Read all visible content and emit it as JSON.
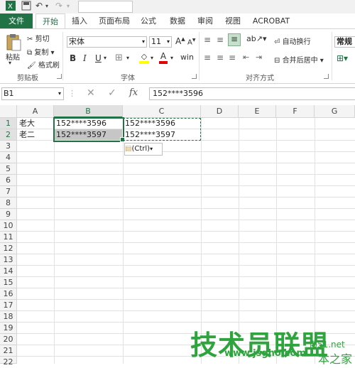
{
  "tabs": [
    "文件",
    "开始",
    "插入",
    "页面布局",
    "公式",
    "数据",
    "审阅",
    "视图",
    "ACROBAT"
  ],
  "clipboard": {
    "paste": "粘贴",
    "cut": "剪切",
    "copy": "复制",
    "format_painter": "格式刷",
    "label": "剪贴板"
  },
  "font": {
    "name": "宋体",
    "size": "11",
    "bold": "B",
    "italic": "I",
    "underline": "U",
    "label": "字体",
    "grow": "A",
    "shrink": "A"
  },
  "alignment": {
    "wrap": "自动换行",
    "merge": "合并后居中",
    "label": "对齐方式"
  },
  "number": {
    "format": "常规"
  },
  "formula_bar": {
    "name_box": "B1",
    "fx": "fx",
    "value": "152****3596"
  },
  "columns": [
    "A",
    "B",
    "C",
    "D",
    "E",
    "F",
    "G"
  ],
  "rows": [
    "1",
    "2",
    "3",
    "4",
    "5",
    "6",
    "7",
    "8",
    "9",
    "10",
    "11",
    "12",
    "13",
    "14",
    "15",
    "16",
    "17",
    "18",
    "19",
    "20",
    "21",
    "22"
  ],
  "cells": {
    "A1": "老大",
    "B1": "152****3596",
    "C1": "152****3596",
    "A2": "老二",
    "B2": "152****3597",
    "C2": "152****3597"
  },
  "paste_options": "(Ctrl)",
  "watermark": {
    "main": "技术员联盟",
    "url": "www.jsgho.com",
    "tail1": "jb51.net",
    "tail2": "本之家"
  },
  "colors": {
    "accent": "#217346",
    "selection": "#c6c6c6",
    "watermark": "#2fa33e"
  }
}
